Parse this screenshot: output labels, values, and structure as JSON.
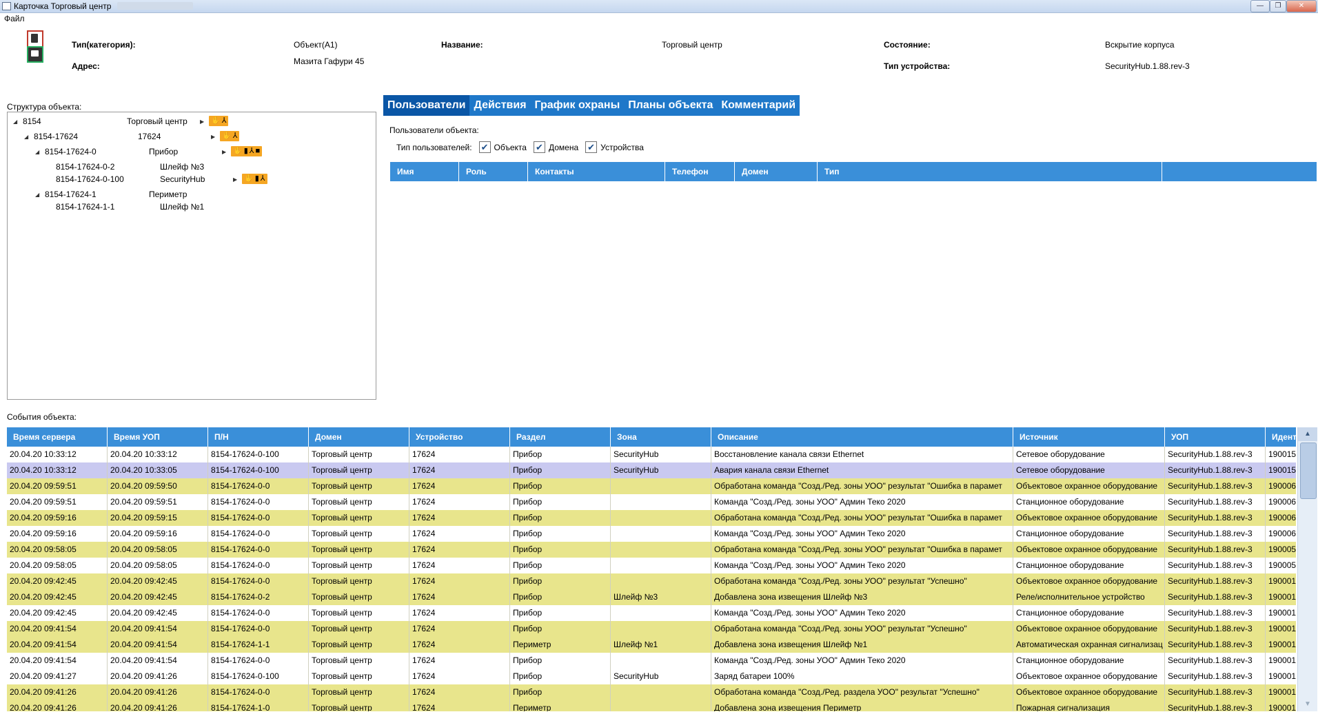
{
  "window": {
    "title": "Карточка Торговый центр"
  },
  "menu": {
    "file": "Файл"
  },
  "info": {
    "type_label": "Тип(категория):",
    "type_value": "Объект(А1)",
    "address_label": "Адрес:",
    "address_value": "Мазита Гафури 45",
    "name_label": "Название:",
    "name_value": "Торговый центр",
    "state_label": "Состояние:",
    "state_value": "Вскрытие корпуса",
    "device_type_label": "Тип устройства:",
    "device_type_value": "SecurityHub.1.88.rev-3"
  },
  "structure": {
    "label": "Структура объекта:",
    "rows": [
      {
        "id": "8154",
        "name": "Торговый центр",
        "badges": [
          "hand-icon",
          "network-icon"
        ]
      },
      {
        "id": "8154-17624",
        "name": "17624",
        "badges": [
          "hand-icon",
          "network-icon"
        ]
      },
      {
        "id": "8154-17624-0",
        "name": "Прибор",
        "badges": [
          "hand-icon",
          "battery-icon",
          "network-icon",
          "lock-icon"
        ]
      },
      {
        "id": "8154-17624-0-2",
        "name": "Шлейф №3",
        "badges": []
      },
      {
        "id": "8154-17624-0-100",
        "name": "SecurityHub",
        "badges": [
          "hand-icon",
          "battery-icon",
          "network-icon"
        ]
      },
      {
        "id": "8154-17624-1",
        "name": "Периметр",
        "badges": []
      },
      {
        "id": "8154-17624-1-1",
        "name": "Шлейф №1",
        "badges": []
      }
    ]
  },
  "tabs": [
    "Пользователи",
    "Действия",
    "График охраны",
    "Планы объекта",
    "Комментарий"
  ],
  "users": {
    "label": "Пользователи объекта:",
    "type_label": "Тип пользователей:",
    "checkboxes": [
      "Объекта",
      "Домена",
      "Устройства"
    ],
    "columns": [
      "Имя",
      "Роль",
      "Контакты",
      "Телефон",
      "Домен",
      "Тип"
    ]
  },
  "events": {
    "label": "События объекта:",
    "columns": [
      "Время сервера",
      "Время УОП",
      "П/Н",
      "Домен",
      "Устройство",
      "Раздел",
      "Зона",
      "Описание",
      "Источник",
      "УОП",
      "Идент"
    ],
    "rows": [
      [
        "20.04.20 10:33:12",
        "20.04.20 10:33:12",
        "8154-17624-0-100",
        "Торговый центр",
        "17624",
        "Прибор",
        "SecurityHub",
        "Восстановление канала связи Ethernet",
        "Сетевое оборудование",
        "SecurityHub.1.88.rev-3",
        "190015"
      ],
      [
        "20.04.20 10:33:12",
        "20.04.20 10:33:05",
        "8154-17624-0-100",
        "Торговый центр",
        "17624",
        "Прибор",
        "SecurityHub",
        "Авария канала связи Ethernet",
        "Сетевое оборудование",
        "SecurityHub.1.88.rev-3",
        "190015"
      ],
      [
        "20.04.20 09:59:51",
        "20.04.20 09:59:50",
        "8154-17624-0-0",
        "Торговый центр",
        "17624",
        "Прибор",
        "",
        "Обработана команда \"Созд./Ред. зоны УОО\" результат \"Ошибка в парамет",
        "Объектовое охранное оборудование",
        "SecurityHub.1.88.rev-3",
        "190006"
      ],
      [
        "20.04.20 09:59:51",
        "20.04.20 09:59:51",
        "8154-17624-0-0",
        "Торговый центр",
        "17624",
        "Прибор",
        "",
        "Команда \"Созд./Ред. зоны УОО\" Админ Теко 2020",
        "Станционное оборудование",
        "SecurityHub.1.88.rev-3",
        "190006"
      ],
      [
        "20.04.20 09:59:16",
        "20.04.20 09:59:15",
        "8154-17624-0-0",
        "Торговый центр",
        "17624",
        "Прибор",
        "",
        "Обработана команда \"Созд./Ред. зоны УОО\" результат \"Ошибка в парамет",
        "Объектовое охранное оборудование",
        "SecurityHub.1.88.rev-3",
        "190006"
      ],
      [
        "20.04.20 09:59:16",
        "20.04.20 09:59:16",
        "8154-17624-0-0",
        "Торговый центр",
        "17624",
        "Прибор",
        "",
        "Команда \"Созд./Ред. зоны УОО\" Админ Теко 2020",
        "Станционное оборудование",
        "SecurityHub.1.88.rev-3",
        "190006"
      ],
      [
        "20.04.20 09:58:05",
        "20.04.20 09:58:05",
        "8154-17624-0-0",
        "Торговый центр",
        "17624",
        "Прибор",
        "",
        "Обработана команда \"Созд./Ред. зоны УОО\" результат \"Ошибка в парамет",
        "Объектовое охранное оборудование",
        "SecurityHub.1.88.rev-3",
        "190005"
      ],
      [
        "20.04.20 09:58:05",
        "20.04.20 09:58:05",
        "8154-17624-0-0",
        "Торговый центр",
        "17624",
        "Прибор",
        "",
        "Команда \"Созд./Ред. зоны УОО\" Админ Теко 2020",
        "Станционное оборудование",
        "SecurityHub.1.88.rev-3",
        "190005"
      ],
      [
        "20.04.20 09:42:45",
        "20.04.20 09:42:45",
        "8154-17624-0-0",
        "Торговый центр",
        "17624",
        "Прибор",
        "",
        "Обработана команда \"Созд./Ред. зоны УОО\" результат \"Успешно\"",
        "Объектовое охранное оборудование",
        "SecurityHub.1.88.rev-3",
        "190001"
      ],
      [
        "20.04.20 09:42:45",
        "20.04.20 09:42:45",
        "8154-17624-0-2",
        "Торговый центр",
        "17624",
        "Прибор",
        "Шлейф №3",
        "Добавлена зона извещения Шлейф №3",
        "Реле/исполнительное устройство",
        "SecurityHub.1.88.rev-3",
        "190001"
      ],
      [
        "20.04.20 09:42:45",
        "20.04.20 09:42:45",
        "8154-17624-0-0",
        "Торговый центр",
        "17624",
        "Прибор",
        "",
        "Команда \"Созд./Ред. зоны УОО\" Админ Теко 2020",
        "Станционное оборудование",
        "SecurityHub.1.88.rev-3",
        "190001"
      ],
      [
        "20.04.20 09:41:54",
        "20.04.20 09:41:54",
        "8154-17624-0-0",
        "Торговый центр",
        "17624",
        "Прибор",
        "",
        "Обработана команда \"Созд./Ред. зоны УОО\" результат \"Успешно\"",
        "Объектовое охранное оборудование",
        "SecurityHub.1.88.rev-3",
        "190001"
      ],
      [
        "20.04.20 09:41:54",
        "20.04.20 09:41:54",
        "8154-17624-1-1",
        "Торговый центр",
        "17624",
        "Периметр",
        "Шлейф №1",
        "Добавлена зона извещения Шлейф №1",
        "Автоматическая охранная сигнализац",
        "SecurityHub.1.88.rev-3",
        "190001"
      ],
      [
        "20.04.20 09:41:54",
        "20.04.20 09:41:54",
        "8154-17624-0-0",
        "Торговый центр",
        "17624",
        "Прибор",
        "",
        "Команда \"Созд./Ред. зоны УОО\" Админ Теко 2020",
        "Станционное оборудование",
        "SecurityHub.1.88.rev-3",
        "190001"
      ],
      [
        "20.04.20 09:41:27",
        "20.04.20 09:41:26",
        "8154-17624-0-100",
        "Торговый центр",
        "17624",
        "Прибор",
        "SecurityHub",
        "Заряд батареи 100%",
        "Объектовое охранное оборудование",
        "SecurityHub.1.88.rev-3",
        "190001"
      ],
      [
        "20.04.20 09:41:26",
        "20.04.20 09:41:26",
        "8154-17624-0-0",
        "Торговый центр",
        "17624",
        "Прибор",
        "",
        "Обработана команда \"Созд./Ред. раздела УОО\" результат \"Успешно\"",
        "Объектовое охранное оборудование",
        "SecurityHub.1.88.rev-3",
        "190001"
      ],
      [
        "20.04.20 09:41:26",
        "20.04.20 09:41:26",
        "8154-17624-1-0",
        "Торговый центр",
        "17624",
        "Периметр",
        "",
        "Добавлена зона извещения Периметр",
        "Пожарная сигнализация",
        "SecurityHub.1.88.rev-3",
        "190001"
      ]
    ],
    "row_colors": [
      "#ffffff",
      "#c9c9f0",
      "#e8e58c",
      "#ffffff",
      "#e8e58c",
      "#ffffff",
      "#e8e58c",
      "#ffffff",
      "#e8e58c",
      "#e8e58c",
      "#ffffff",
      "#e8e58c",
      "#e8e58c",
      "#ffffff",
      "#ffffff",
      "#e8e58c",
      "#e8e58c"
    ]
  },
  "colors": {
    "accent": "#1f78c9",
    "header": "#3a8fd9",
    "badge": "#f5a623"
  }
}
